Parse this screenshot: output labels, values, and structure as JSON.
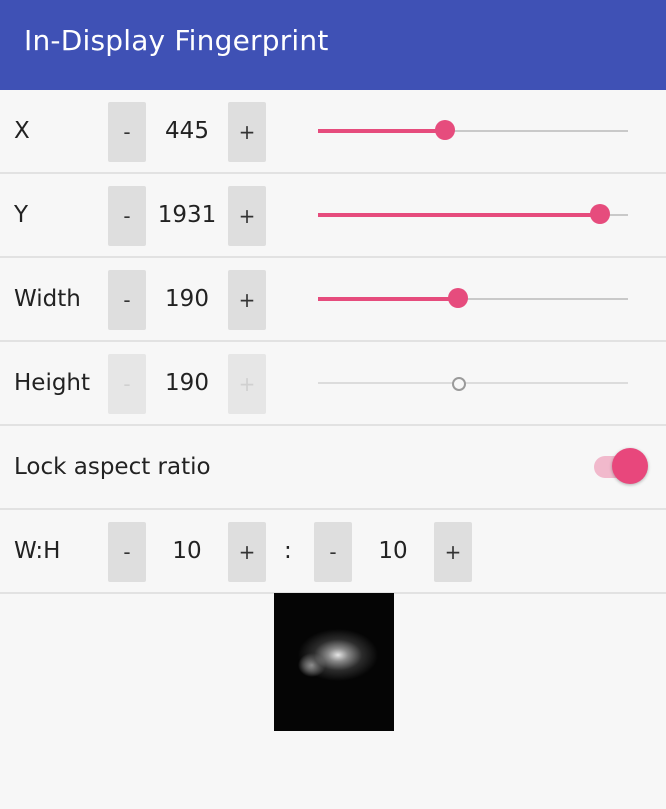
{
  "app": {
    "title": "In-Display Fingerprint"
  },
  "colors": {
    "appbar": "#3f51b5",
    "accent": "#e64c7d"
  },
  "rows": {
    "x": {
      "label": "X",
      "minus": "-",
      "plus": "+",
      "value": "445",
      "slider_fraction": 0.41
    },
    "y": {
      "label": "Y",
      "minus": "-",
      "plus": "+",
      "value": "1931",
      "slider_fraction": 0.91
    },
    "width": {
      "label": "Width",
      "minus": "-",
      "plus": "+",
      "value": "190",
      "slider_fraction": 0.45
    },
    "height": {
      "label": "Height",
      "minus": "-",
      "plus": "+",
      "value": "190",
      "slider_fraction": 0.45,
      "disabled": true
    }
  },
  "lock": {
    "label": "Lock aspect ratio",
    "checked": true
  },
  "ratio": {
    "label": "W:H",
    "w_minus": "-",
    "w_value": "10",
    "w_plus": "+",
    "separator": ":",
    "h_minus": "-",
    "h_value": "10",
    "h_plus": "+"
  },
  "preview": {
    "icon": "fingerprint-glow-preview"
  }
}
